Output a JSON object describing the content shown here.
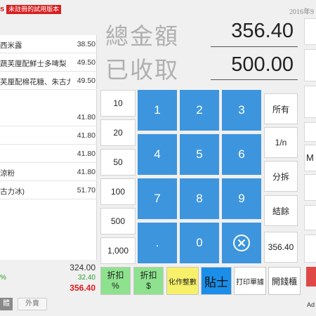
{
  "header": {
    "badge_letter": "s",
    "trial_badge": "未註冊的試用版本",
    "date": "2016年9"
  },
  "orders": [
    {
      "name": "西米露",
      "price": "38.50"
    },
    {
      "name": "蔬芙厘配鮮士多啤梨",
      "price": "49.50"
    },
    {
      "name": "芙厘配棉花糖、朱古力",
      "price": "49.50"
    },
    {
      "name": "",
      "price": "41.80"
    },
    {
      "name": "",
      "price": "41.80"
    },
    {
      "name": "",
      "price": "41.80"
    },
    {
      "name": "涼粉",
      "price": "41.80"
    },
    {
      "name": "古力冰)",
      "price": "51.70"
    }
  ],
  "summary": {
    "subtotal": "324.00",
    "percent_mark": "%",
    "discount": "32.40",
    "total": "356.40"
  },
  "tabs": {
    "dine_in": "體",
    "takeout": "外賣"
  },
  "display": {
    "total_label": "總金額",
    "total_amount": "356.40",
    "received_label": "已收取",
    "received_amount": "500.00"
  },
  "quick_amounts": [
    "10",
    "20",
    "50",
    "100",
    "500",
    "1,000"
  ],
  "keypad": {
    "k1": "1",
    "k2": "2",
    "k3": "3",
    "k4": "4",
    "k5": "5",
    "k6": "6",
    "k7": "7",
    "k8": "8",
    "k9": "9",
    "dot": ".",
    "k0": "0"
  },
  "side_buttons": {
    "all": "所有",
    "one_nth": "1/n",
    "split": "分拆",
    "balance": "結餘",
    "amount": "356.40"
  },
  "bottom_buttons": {
    "discount_percent_line1": "折扣",
    "discount_percent_line2": "%",
    "discount_amount_line1": "折扣",
    "discount_amount_line2": "$",
    "round_off": "化作整數",
    "tip": "貼士",
    "print_receipt": "打印單據",
    "open_drawer": "開錢櫃"
  },
  "right_strip": {
    "m_label": "M",
    "ad_label": "Ad"
  },
  "colors": {
    "keypad_blue": "#3d95de",
    "discount_green": "#8ee28e",
    "round_yellow": "#f6f06a",
    "tip_blue": "#1a8ee8",
    "total_red": "#e01a1a",
    "trial_red": "#d62020"
  }
}
